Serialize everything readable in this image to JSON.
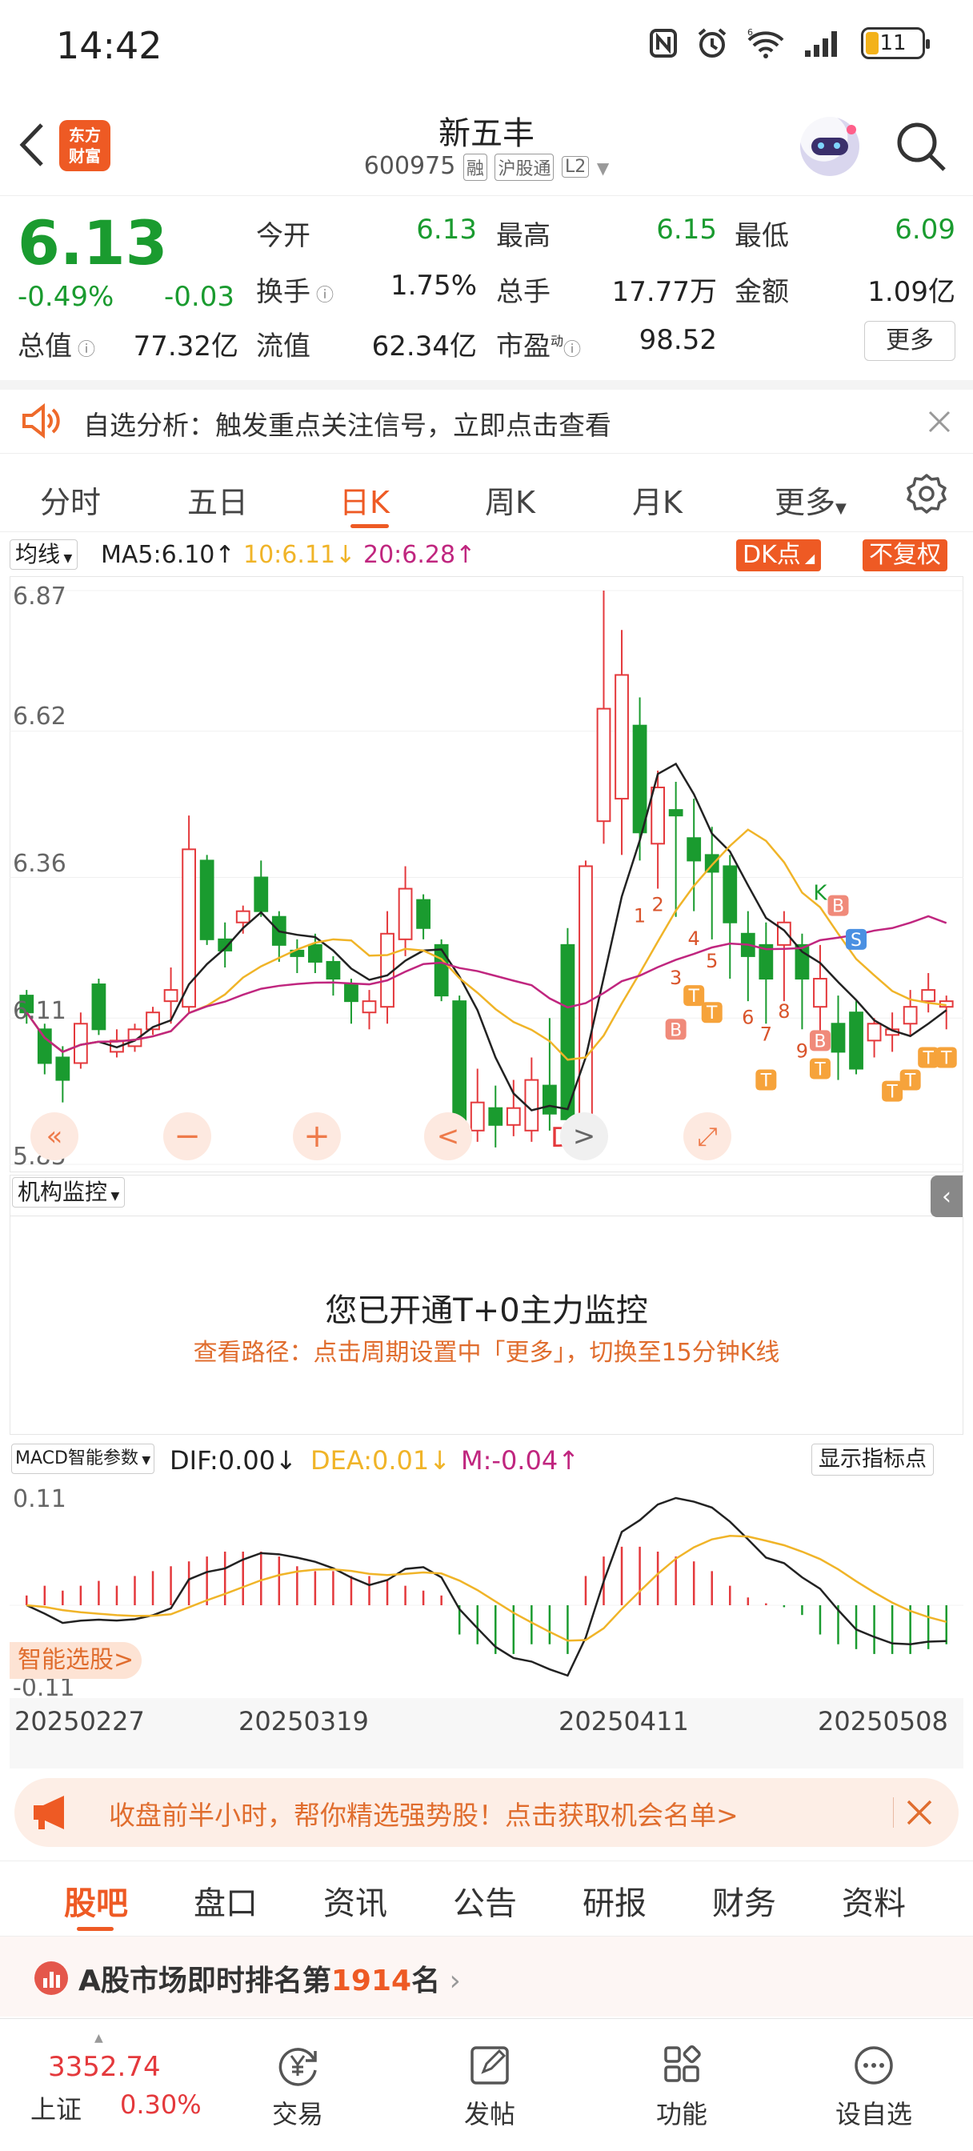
{
  "status_bar": {
    "time": "14:42",
    "battery": "11",
    "icons": [
      "nfc-icon",
      "alarm-icon",
      "wifi-6-icon",
      "signal-icon",
      "battery-icon"
    ]
  },
  "header": {
    "app_logo_line1": "东方",
    "app_logo_line2": "财富",
    "title": "新五丰",
    "code": "600975",
    "tag_margin": "融",
    "tag_connect": "沪股通",
    "tag_level": "L2"
  },
  "quote": {
    "price": "6.13",
    "change_pct": "-0.49%",
    "change_amt": "-0.03",
    "rows": [
      [
        {
          "label": "今开",
          "value": "6.13",
          "color": "#1a9b2f"
        },
        {
          "label": "最高",
          "value": "6.15",
          "color": "#1a9b2f"
        },
        {
          "label": "最低",
          "value": "6.09",
          "color": "#1a9b2f"
        }
      ],
      [
        {
          "label": "换手",
          "value": "1.75%",
          "color": "#222222"
        },
        {
          "label": "总手",
          "value": "17.77万",
          "color": "#222222"
        },
        {
          "label": "金额",
          "value": "1.09亿",
          "color": "#222222"
        }
      ]
    ],
    "total_cap_label": "总值",
    "total_cap": "77.32亿",
    "float_cap_label": "流值",
    "float_cap": "62.34亿",
    "pe_label": "市盈",
    "pe_sup": "动",
    "pe": "98.52",
    "more_label": "更多"
  },
  "notice": {
    "text": "自选分析：触发重点关注信号，立即点击查看"
  },
  "period_tabs": {
    "items": [
      "分时",
      "五日",
      "日K",
      "周K",
      "月K",
      "更多"
    ],
    "active": "日K"
  },
  "kline": {
    "ma_selector": "均线",
    "ma5": "MA5:6.10↑",
    "ma10": "10:6.11↓",
    "ma20": "20:6.28↑",
    "dk_button": "DK点",
    "adjust_button": "不复权",
    "y_ticks": [
      "6.87",
      "6.62",
      "6.36",
      "6.11",
      "5.85"
    ],
    "colors": {
      "up": "#e4393c",
      "down": "#1a9b2f",
      "ma5": "#222222",
      "ma10": "#f0b428",
      "ma20": "#c0267f"
    }
  },
  "chart_data": {
    "type": "candlestick",
    "ylim": [
      5.85,
      6.87
    ],
    "candles": [
      {
        "o": 6.15,
        "c": 6.12,
        "h": 6.16,
        "l": 6.1
      },
      {
        "o": 6.09,
        "c": 6.03,
        "h": 6.1,
        "l": 6.01
      },
      {
        "o": 6.04,
        "c": 6.0,
        "h": 6.06,
        "l": 5.96
      },
      {
        "o": 6.03,
        "c": 6.1,
        "h": 6.12,
        "l": 6.02
      },
      {
        "o": 6.17,
        "c": 6.09,
        "h": 6.18,
        "l": 6.08
      },
      {
        "o": 6.05,
        "c": 6.07,
        "h": 6.09,
        "l": 6.04
      },
      {
        "o": 6.06,
        "c": 6.09,
        "h": 6.1,
        "l": 6.05
      },
      {
        "o": 6.09,
        "c": 6.12,
        "h": 6.13,
        "l": 6.08
      },
      {
        "o": 6.14,
        "c": 6.16,
        "h": 6.2,
        "l": 6.1
      },
      {
        "o": 6.13,
        "c": 6.41,
        "h": 6.47,
        "l": 6.12
      },
      {
        "o": 6.39,
        "c": 6.25,
        "h": 6.4,
        "l": 6.24
      },
      {
        "o": 6.25,
        "c": 6.23,
        "h": 6.28,
        "l": 6.2
      },
      {
        "o": 6.28,
        "c": 6.3,
        "h": 6.31,
        "l": 6.26
      },
      {
        "o": 6.36,
        "c": 6.3,
        "h": 6.39,
        "l": 6.29
      },
      {
        "o": 6.29,
        "c": 6.24,
        "h": 6.3,
        "l": 6.21
      },
      {
        "o": 6.23,
        "c": 6.22,
        "h": 6.25,
        "l": 6.19
      },
      {
        "o": 6.24,
        "c": 6.21,
        "h": 6.26,
        "l": 6.19
      },
      {
        "o": 6.21,
        "c": 6.18,
        "h": 6.22,
        "l": 6.15
      },
      {
        "o": 6.17,
        "c": 6.14,
        "h": 6.18,
        "l": 6.1
      },
      {
        "o": 6.12,
        "c": 6.14,
        "h": 6.16,
        "l": 6.09
      },
      {
        "o": 6.13,
        "c": 6.26,
        "h": 6.3,
        "l": 6.1
      },
      {
        "o": 6.25,
        "c": 6.34,
        "h": 6.38,
        "l": 6.22
      },
      {
        "o": 6.32,
        "c": 6.27,
        "h": 6.33,
        "l": 6.25
      },
      {
        "o": 6.24,
        "c": 6.15,
        "h": 6.25,
        "l": 6.14
      },
      {
        "o": 6.14,
        "c": 5.9,
        "h": 6.15,
        "l": 5.88
      },
      {
        "o": 5.91,
        "c": 5.96,
        "h": 6.02,
        "l": 5.89
      },
      {
        "o": 5.95,
        "c": 5.92,
        "h": 5.99,
        "l": 5.88
      },
      {
        "o": 5.92,
        "c": 5.95,
        "h": 6.0,
        "l": 5.9
      },
      {
        "o": 5.91,
        "c": 6.0,
        "h": 6.04,
        "l": 5.89
      },
      {
        "o": 5.99,
        "c": 5.94,
        "h": 6.11,
        "l": 5.91
      },
      {
        "o": 6.24,
        "c": 5.93,
        "h": 6.27,
        "l": 5.87
      },
      {
        "o": 5.93,
        "c": 6.38,
        "h": 6.39,
        "l": 5.92
      },
      {
        "o": 6.46,
        "c": 6.66,
        "h": 6.87,
        "l": 6.42
      },
      {
        "o": 6.5,
        "c": 6.72,
        "h": 6.8,
        "l": 6.4
      },
      {
        "o": 6.63,
        "c": 6.44,
        "h": 6.68,
        "l": 6.39
      },
      {
        "o": 6.42,
        "c": 6.52,
        "h": 6.55,
        "l": 6.34
      },
      {
        "o": 6.48,
        "c": 6.47,
        "h": 6.53,
        "l": 6.29
      },
      {
        "o": 6.43,
        "c": 6.39,
        "h": 6.5,
        "l": 6.3
      },
      {
        "o": 6.4,
        "c": 6.37,
        "h": 6.45,
        "l": 6.25
      },
      {
        "o": 6.38,
        "c": 6.28,
        "h": 6.4,
        "l": 6.18
      },
      {
        "o": 6.26,
        "c": 6.22,
        "h": 6.3,
        "l": 6.14
      },
      {
        "o": 6.24,
        "c": 6.18,
        "h": 6.28,
        "l": 6.1
      },
      {
        "o": 6.24,
        "c": 6.28,
        "h": 6.3,
        "l": 6.14
      },
      {
        "o": 6.24,
        "c": 6.18,
        "h": 6.26,
        "l": 6.09
      },
      {
        "o": 6.13,
        "c": 6.18,
        "h": 6.24,
        "l": 6.08
      },
      {
        "o": 6.1,
        "c": 6.05,
        "h": 6.15,
        "l": 6.0
      },
      {
        "o": 6.12,
        "c": 6.02,
        "h": 6.14,
        "l": 6.01
      },
      {
        "o": 6.07,
        "c": 6.1,
        "h": 6.11,
        "l": 6.04
      },
      {
        "o": 6.08,
        "c": 6.09,
        "h": 6.12,
        "l": 6.05
      },
      {
        "o": 6.1,
        "c": 6.13,
        "h": 6.16,
        "l": 6.08
      },
      {
        "o": 6.14,
        "c": 6.16,
        "h": 6.19,
        "l": 6.12
      },
      {
        "o": 6.13,
        "c": 6.14,
        "h": 6.15,
        "l": 6.09
      }
    ],
    "macd": {
      "ylim": [
        -0.11,
        0.11
      ],
      "y_ticks": [
        "0.11",
        "-0.11"
      ],
      "x_labels": [
        "20250227",
        "20250319",
        "20250411",
        "20250508"
      ],
      "dif_label": "DIF:0.00↓",
      "dea_label": "DEA:0.01↓",
      "m_label": "M:-0.04↑",
      "selector": "MACD智能参数",
      "show_points": "显示指标点",
      "hist": [
        0.01,
        0.02,
        0.015,
        0.02,
        0.025,
        0.02,
        0.03,
        0.035,
        0.04,
        0.045,
        0.05,
        0.055,
        0.055,
        0.055,
        0.05,
        0.04,
        0.035,
        0.035,
        0.03,
        0.03,
        0.025,
        0.02,
        0.015,
        0.01,
        -0.03,
        -0.04,
        -0.05,
        -0.05,
        -0.04,
        -0.04,
        -0.05,
        0.03,
        0.05,
        0.06,
        0.06,
        0.055,
        0.05,
        0.045,
        0.035,
        0.02,
        0.008,
        0.002,
        -0.002,
        -0.01,
        -0.03,
        -0.04,
        -0.045,
        -0.05,
        -0.05,
        -0.05,
        -0.045,
        -0.04
      ]
    }
  },
  "kline_tools": {
    "left": "«",
    "minus": "−",
    "plus": "+",
    "prev": "<",
    "d_marker": "D",
    "next": ">",
    "fullscreen": "⤢"
  },
  "markers": {
    "b_marker": "B",
    "s_marker": "S",
    "t_marker": "T",
    "k_marker": "K",
    "numbers": [
      "1",
      "2",
      "3",
      "4",
      "5",
      "6",
      "7",
      "8",
      "9"
    ]
  },
  "monitor": {
    "selector": "机构监控",
    "title": "您已开通T+0主力监控",
    "path": "查看路径：点击周期设置中「更多」，切换至15分钟K线"
  },
  "smart_pick": "智能选股",
  "promo": {
    "text": "收盘前半小时，帮你精选强势股！点击获取机会名单>"
  },
  "bottom_tabs": {
    "items": [
      "股吧",
      "盘口",
      "资讯",
      "公告",
      "研报",
      "财务",
      "资料"
    ],
    "active": "股吧"
  },
  "rank": {
    "prefix": "A股市场即时排名第",
    "number": "1914",
    "suffix": "名"
  },
  "bottom_nav": {
    "index_value": "3352.74",
    "index_name": "上证",
    "index_change": "0.30%",
    "items": [
      {
        "label": "交易",
        "icon": "yen-cycle-icon"
      },
      {
        "label": "发帖",
        "icon": "edit-icon"
      },
      {
        "label": "功能",
        "icon": "grid-icon"
      },
      {
        "label": "设自选",
        "icon": "more-dots-icon"
      }
    ]
  }
}
